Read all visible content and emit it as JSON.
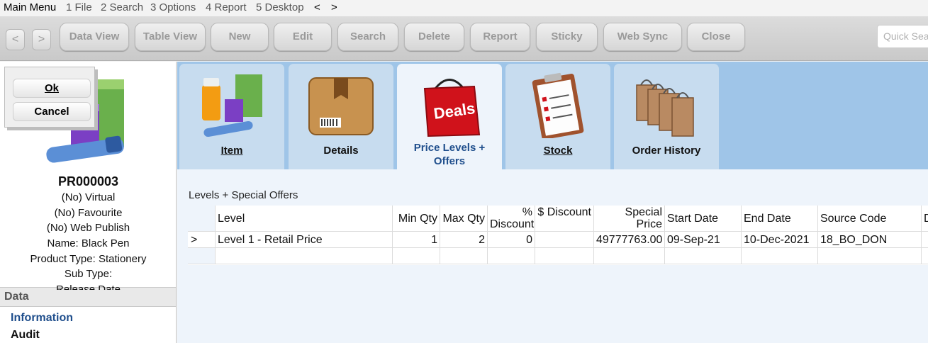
{
  "menu": {
    "items": [
      "Main Menu",
      "1 File",
      "2 Search",
      "3 Options",
      "4 Report",
      "5 Desktop",
      "<",
      ">"
    ]
  },
  "toolbar": {
    "back": "<",
    "forward": ">",
    "buttons": [
      "Data View",
      "Table View",
      "New",
      "Edit",
      "Search",
      "Delete",
      "Report",
      "Sticky",
      "Web Sync",
      "Close"
    ],
    "quick_search_placeholder": "Quick Sea"
  },
  "dialog": {
    "ok": "Ok",
    "cancel": "Cancel"
  },
  "product": {
    "code": "PR000003",
    "lines": [
      "(No) Virtual",
      "(No) Favourite",
      "(No) Web Publish",
      "Name: Black Pen",
      "Product Type: Stationery",
      "Sub Type:",
      "Release Date"
    ]
  },
  "data_section": {
    "header": "Data",
    "links": [
      "Information",
      "Audit"
    ]
  },
  "tabs": [
    {
      "label": "Item",
      "icon": "bottles-icon"
    },
    {
      "label": "Details",
      "icon": "box-icon"
    },
    {
      "label": "Price Levels + Offers",
      "icon": "deals-bag-icon"
    },
    {
      "label": "Stock",
      "icon": "inventory-clipboard-icon"
    },
    {
      "label": "Order History",
      "icon": "shopping-bags-icon"
    }
  ],
  "colors": {
    "accent": "#1f4e8c",
    "tab_strip": "#9fc5e8",
    "tab": "#c7dcef",
    "active_tab": "#eef4fb"
  },
  "grid": {
    "caption": "Levels + Special Offers",
    "columns": [
      "Level",
      "Min Qty",
      "Max Qty",
      "% Discount",
      "$ Discount",
      "Special Price",
      "Start Date",
      "End Date",
      "Source Code",
      "D"
    ],
    "rows": [
      {
        "marker": ">",
        "level": "Level 1 - Retail Price",
        "min_qty": "1",
        "max_qty": "2",
        "pct_discount": "0",
        "dollar_discount": "",
        "special_price": "49777763.00",
        "start_date": "09-Sep-21",
        "end_date": "10-Dec-2021",
        "source_code": "18_BO_DON"
      }
    ]
  }
}
